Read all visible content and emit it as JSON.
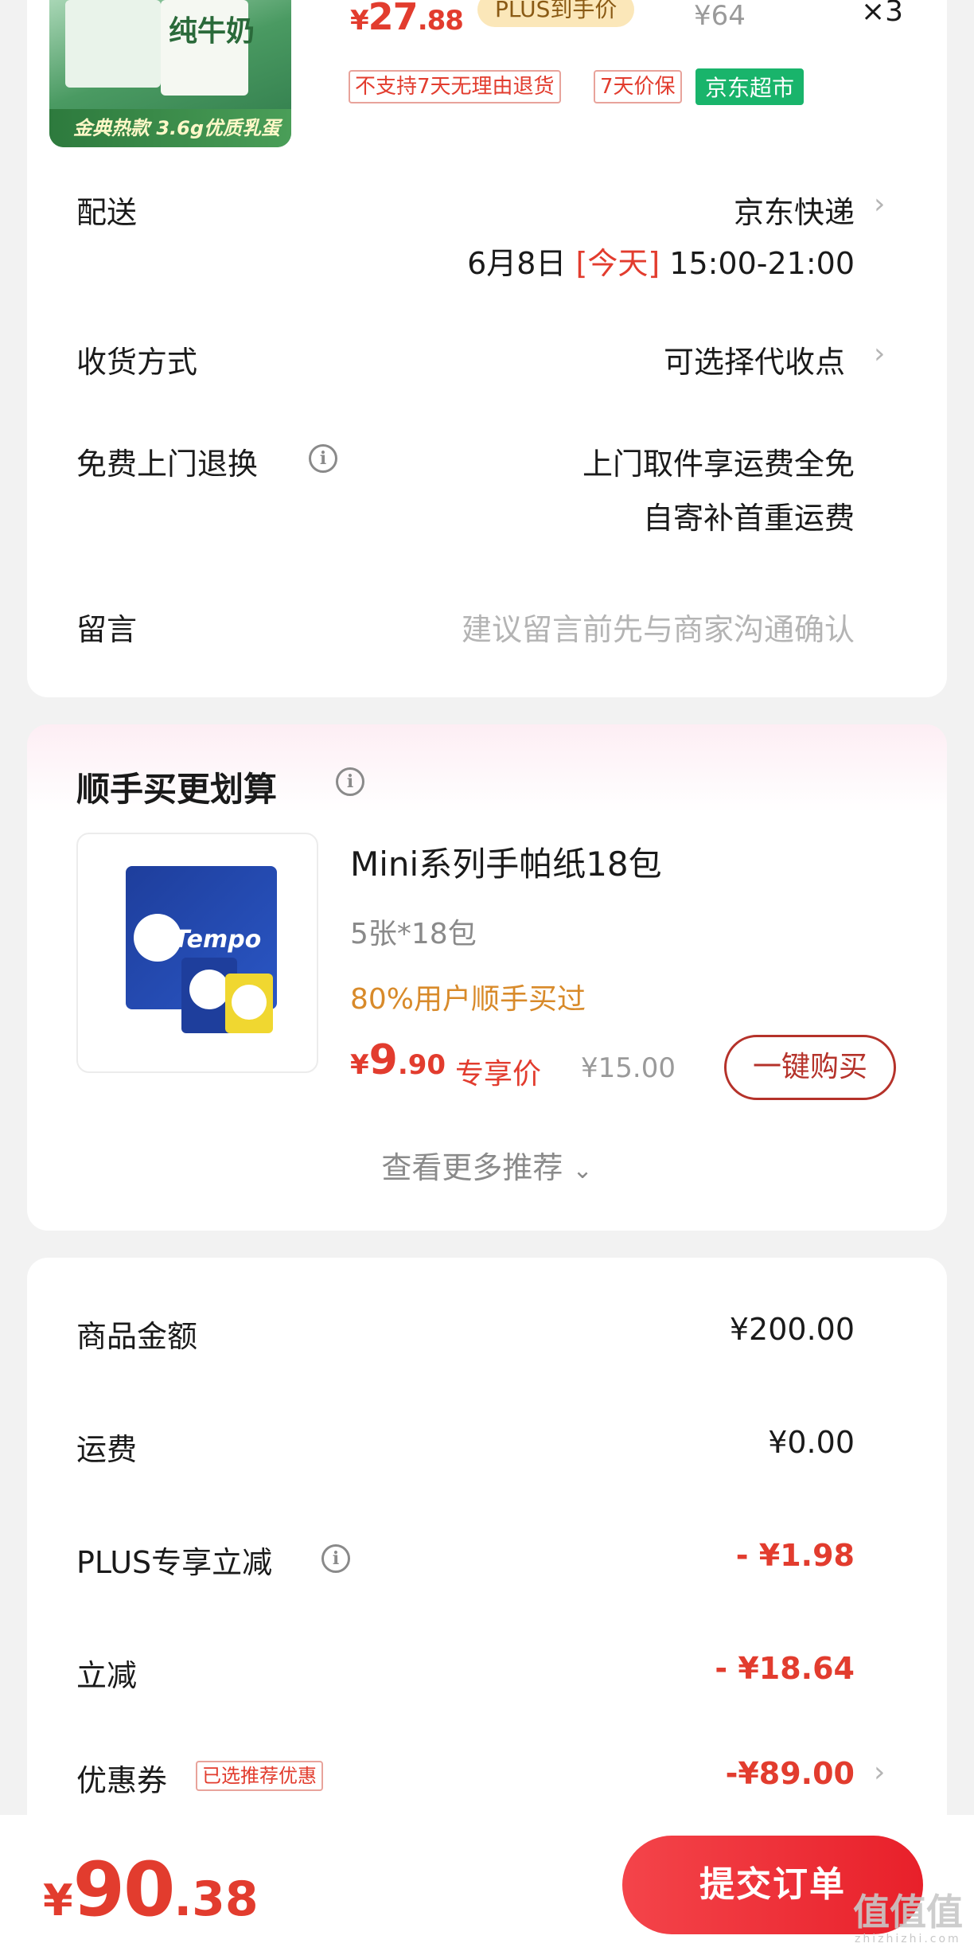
{
  "product_top": {
    "thumb_label": "纯牛奶",
    "thumb_banner": "金典热款 3.6g优质乳蛋白",
    "price_symbol": "¥",
    "price_int": "27",
    "price_dec": ".88",
    "plus_label": "PLUS到手价",
    "original_price": "¥64",
    "quantity": "×3",
    "tags": [
      "不支持7天无理由退货",
      "7天价保",
      "京东超市"
    ]
  },
  "order_rows": {
    "delivery": {
      "label": "配送",
      "carrier": "京东快递",
      "date": "6月8日",
      "today": "[今天]",
      "time": "15:00-21:00"
    },
    "receipt": {
      "label": "收货方式",
      "value": "可选择代收点"
    },
    "returns": {
      "label": "免费上门退换",
      "line1": "上门取件享运费全免",
      "line2": "自寄补首重运费"
    },
    "message": {
      "label": "留言",
      "placeholder": "建议留言前先与商家沟通确认"
    }
  },
  "recommend": {
    "title": "顺手买更划算",
    "item": {
      "name": "Mini系列手帕纸18包",
      "spec": "5张*18包",
      "buyers": "80%用户顺手买过",
      "price_symbol": "¥",
      "price_int": "9",
      "price_dec": ".90",
      "price_label": "专享价",
      "original_price": "¥15.00",
      "button": "一键购买",
      "thumb_logo": "Tempo"
    },
    "more": "查看更多推荐"
  },
  "summary": {
    "goods": {
      "label": "商品金额",
      "value": "¥200.00"
    },
    "shipping": {
      "label": "运费",
      "value": "¥0.00"
    },
    "plus_discount": {
      "label": "PLUS专享立减",
      "value": "- ¥1.98"
    },
    "discount": {
      "label": "立减",
      "value": "- ¥18.64"
    },
    "coupon": {
      "label": "优惠券",
      "badge": "已选推荐优惠",
      "value": "-¥89.00"
    }
  },
  "bottom": {
    "total_symbol": "¥",
    "total_int": "90",
    "total_dec": ".38",
    "submit": "提交订单",
    "watermark": "值值值",
    "watermark_sub": "zhizhizhi.com"
  },
  "colors": {
    "accent_red": "#e23c2e",
    "jd_green": "#19b46b",
    "plus_gold": "#fbe7b9",
    "buyers_orange": "#d88a2a"
  }
}
